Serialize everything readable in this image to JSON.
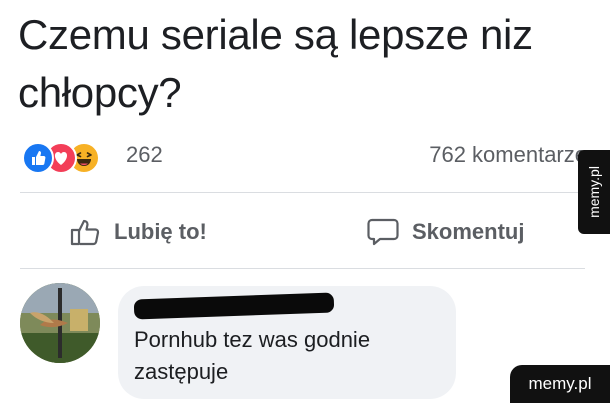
{
  "post": {
    "text_line1": "Czemu seriale są lepsze niz",
    "text_line2": "chłopcy?"
  },
  "reactions": {
    "icons": [
      "like-icon",
      "love-icon",
      "haha-icon"
    ],
    "count": "262",
    "comments_label": "762 komentarze"
  },
  "actions": {
    "like_label": "Lubię to!",
    "comment_label": "Skomentuj"
  },
  "comment": {
    "text": "Pornhub tez was godnie zastępuje"
  },
  "watermarks": {
    "side": "memy.pl",
    "corner": "memy.pl"
  },
  "colors": {
    "like_blue": "#1877f2",
    "love_red": "#f33e58",
    "haha_yellow": "#f7b125",
    "muted_text": "#5b5e63",
    "bubble_bg": "#f0f2f5"
  }
}
